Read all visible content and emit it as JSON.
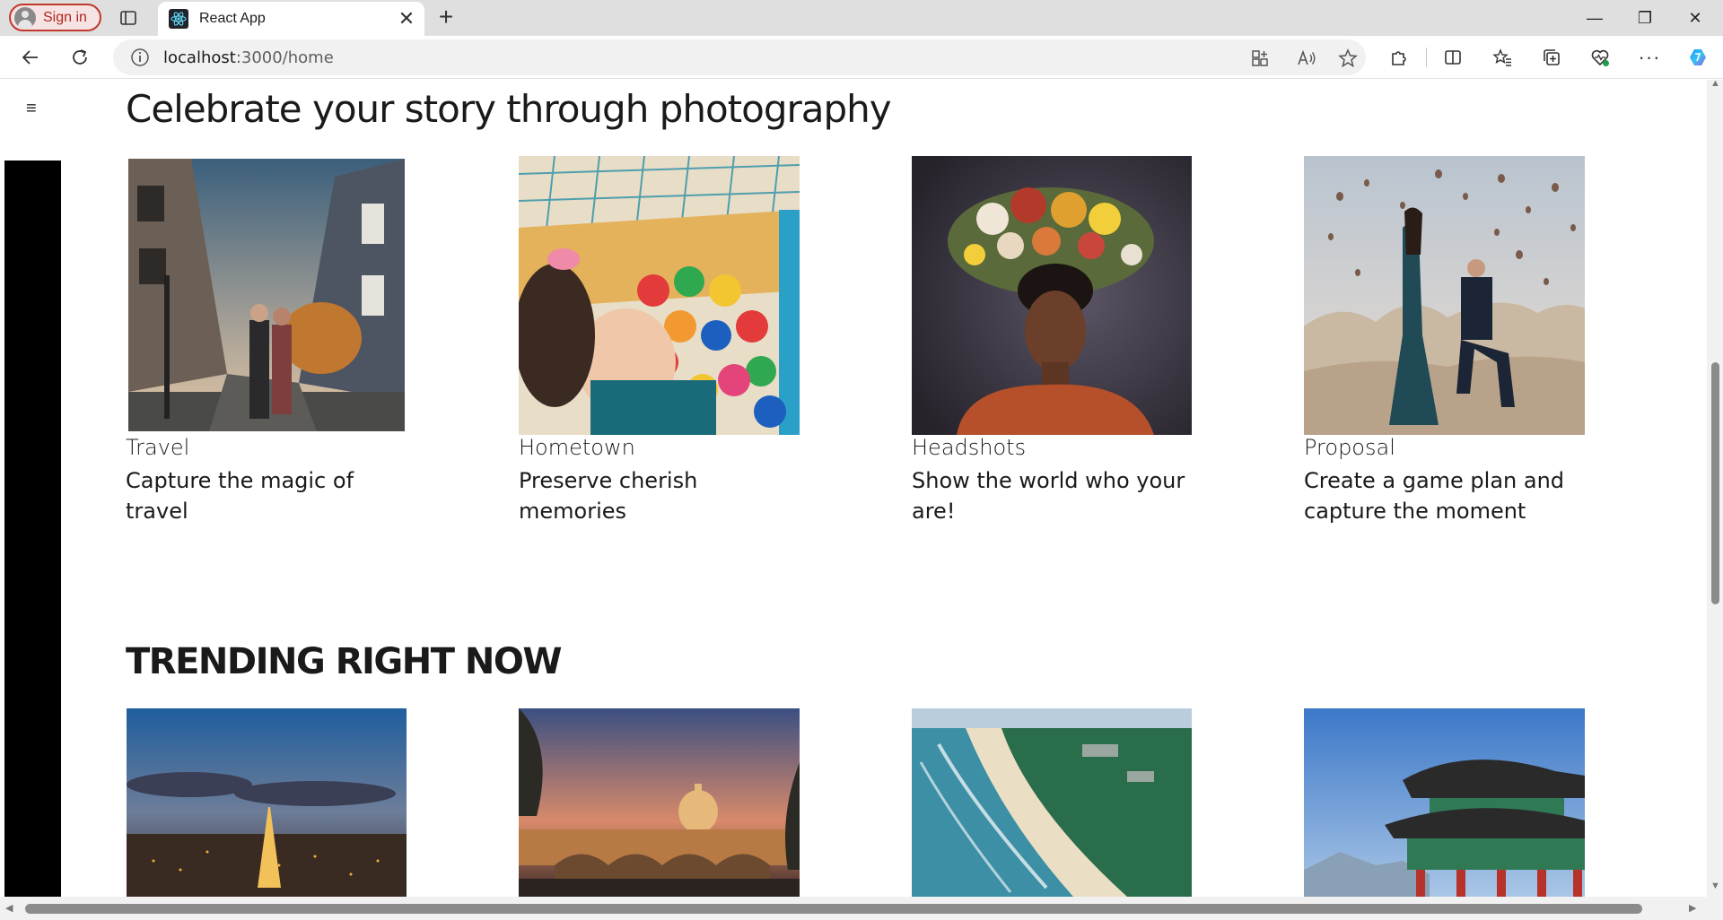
{
  "browser": {
    "signin_label": "Sign in",
    "tab_title": "React App",
    "tab_close": "✕",
    "new_tab": "+",
    "url_host": "localhost",
    "url_path": ":3000/home",
    "window": {
      "minimize": "—",
      "restore": "❐",
      "close": "✕"
    }
  },
  "page": {
    "menu_icon": "≡",
    "heading": "Celebrate your story through photography",
    "categories": [
      {
        "title": "Travel",
        "description": "Capture the magic of travel"
      },
      {
        "title": "Hometown",
        "description": "Preserve cherish memories"
      },
      {
        "title": "Headshots",
        "description": "Show the world who your are!"
      },
      {
        "title": "Proposal",
        "description": "Create a game plan and capture the moment"
      }
    ],
    "trending_heading": "TRENDING RIGHT NOW",
    "trending": [
      {
        "icon": "paris-eiffel-night-photo"
      },
      {
        "icon": "rome-vatican-dusk-photo"
      },
      {
        "icon": "coastal-beach-aerial-photo"
      },
      {
        "icon": "korean-palace-photo"
      }
    ]
  },
  "colors": {
    "signin_accent": "#c0392b",
    "page_bg": "#ffffff",
    "text": "#1a1a1a"
  }
}
